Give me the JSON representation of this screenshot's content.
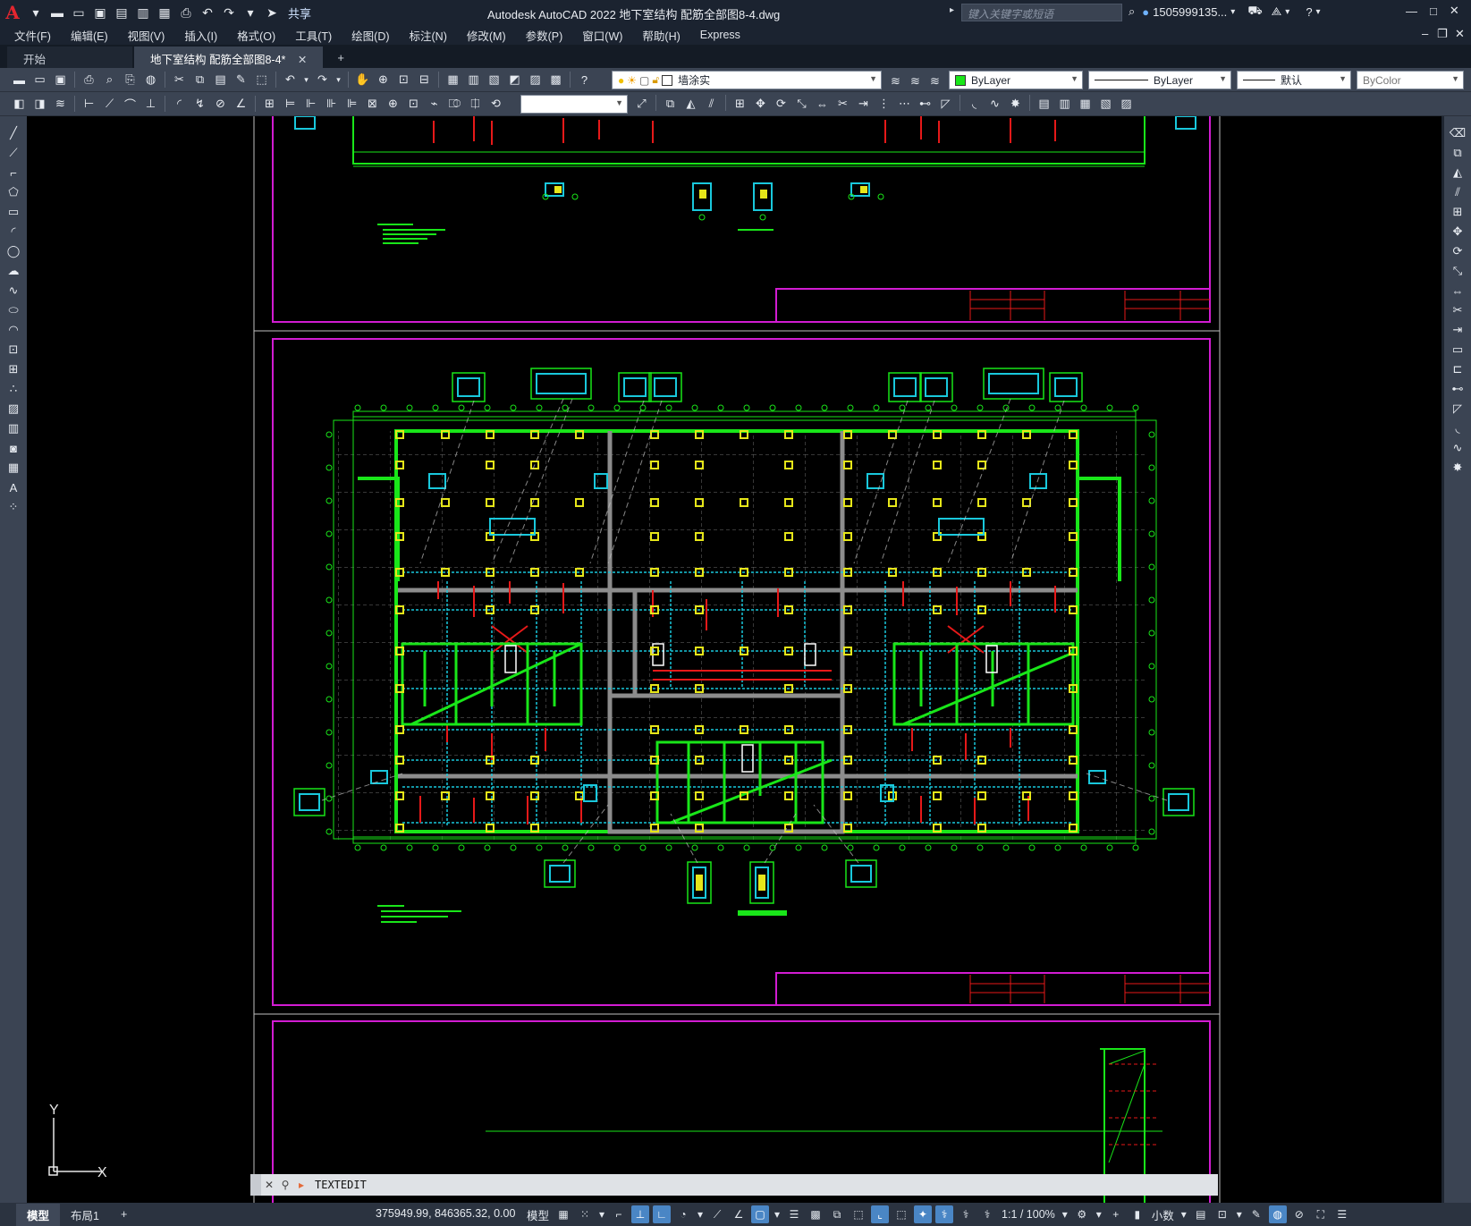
{
  "app": {
    "title": "Autodesk AutoCAD 2022    地下室结构 配筋全部图8-4.dwg",
    "share_label": "共享",
    "search_placeholder": "键入关键字或短语",
    "user_label": "1505999135...",
    "logo_letter": "A"
  },
  "menu": [
    "文件(F)",
    "编辑(E)",
    "视图(V)",
    "插入(I)",
    "格式(O)",
    "工具(T)",
    "绘图(D)",
    "标注(N)",
    "修改(M)",
    "参数(P)",
    "窗口(W)",
    "帮助(H)",
    "Express"
  ],
  "tabs": {
    "start": "开始",
    "active": "地下室结构 配筋全部图8-4*"
  },
  "properties": {
    "layer": "墙涂实",
    "color": "ByLayer",
    "linetype": "ByLayer",
    "lineweight": "默认",
    "plotstyle": "ByColor"
  },
  "ucs": {
    "y": "Y",
    "x": "X"
  },
  "command": {
    "text": "TEXTEDIT"
  },
  "status": {
    "model_tab": "模型",
    "layout_tab": "布局1",
    "coordinates": "375949.99, 846365.32, 0.00",
    "space": "模型",
    "scale": "1:1 / 100%",
    "units": "小数"
  },
  "colors": {
    "frame_magenta": "#d21cd2",
    "wall_green": "#19e619",
    "column_yellow": "#e6e619",
    "rebar_cyan": "#19c8dc",
    "rebar_red": "#e61919",
    "axis_gray": "#8c8c8c",
    "ui_dark": "#3b4453"
  }
}
